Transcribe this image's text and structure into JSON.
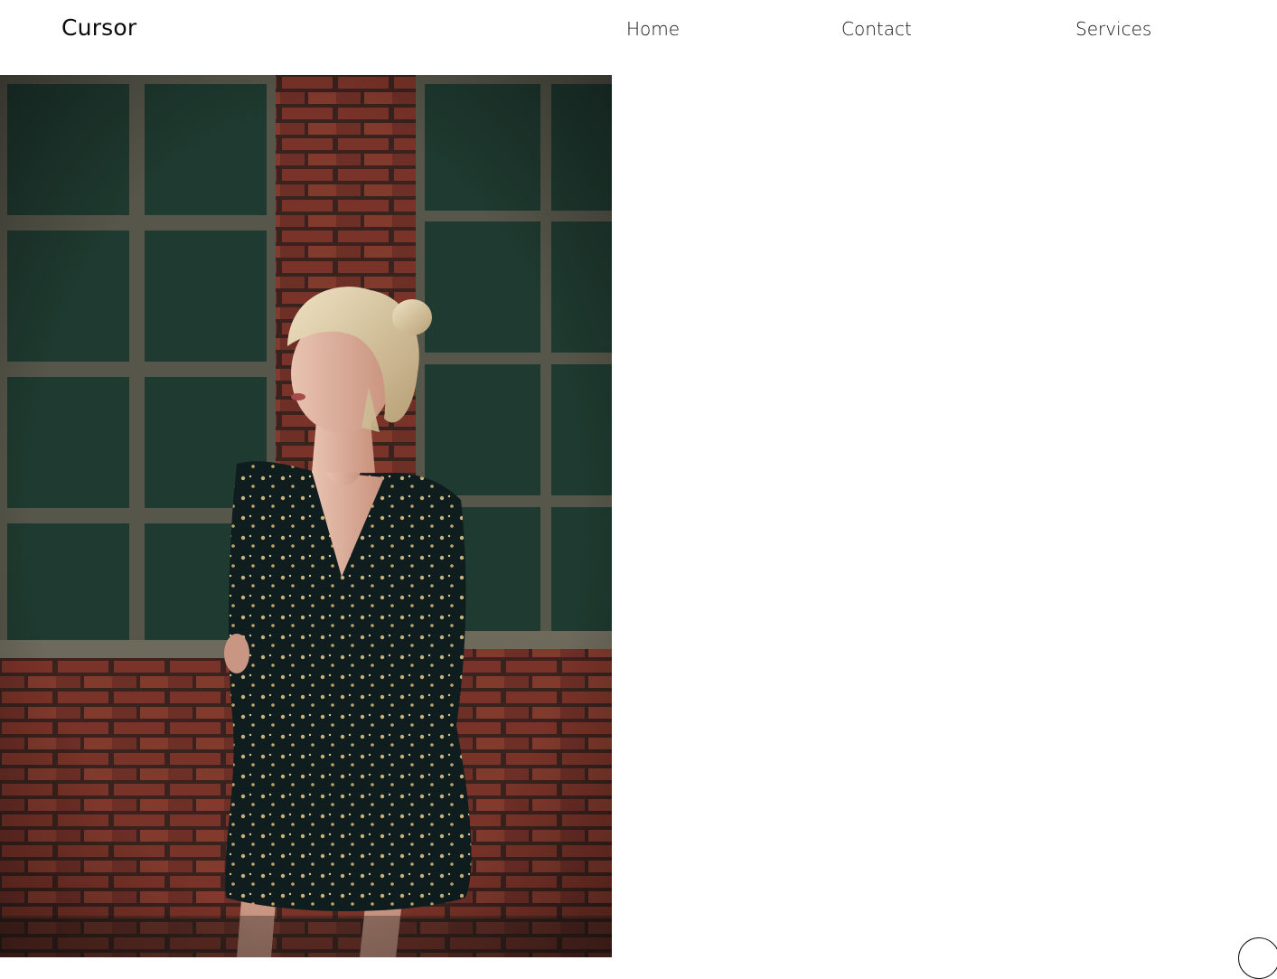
{
  "header": {
    "brand": "Cursor",
    "nav": {
      "home": "Home",
      "contact": "Contact",
      "services": "Services"
    }
  },
  "hero": {
    "image_icon": "photo-woman-brick-wall"
  },
  "colors": {
    "background": "#ffffff",
    "text": "#111111",
    "wall_glass": "#1f3a30",
    "brick": "#7a3328",
    "dress": "#0f1d1f"
  }
}
